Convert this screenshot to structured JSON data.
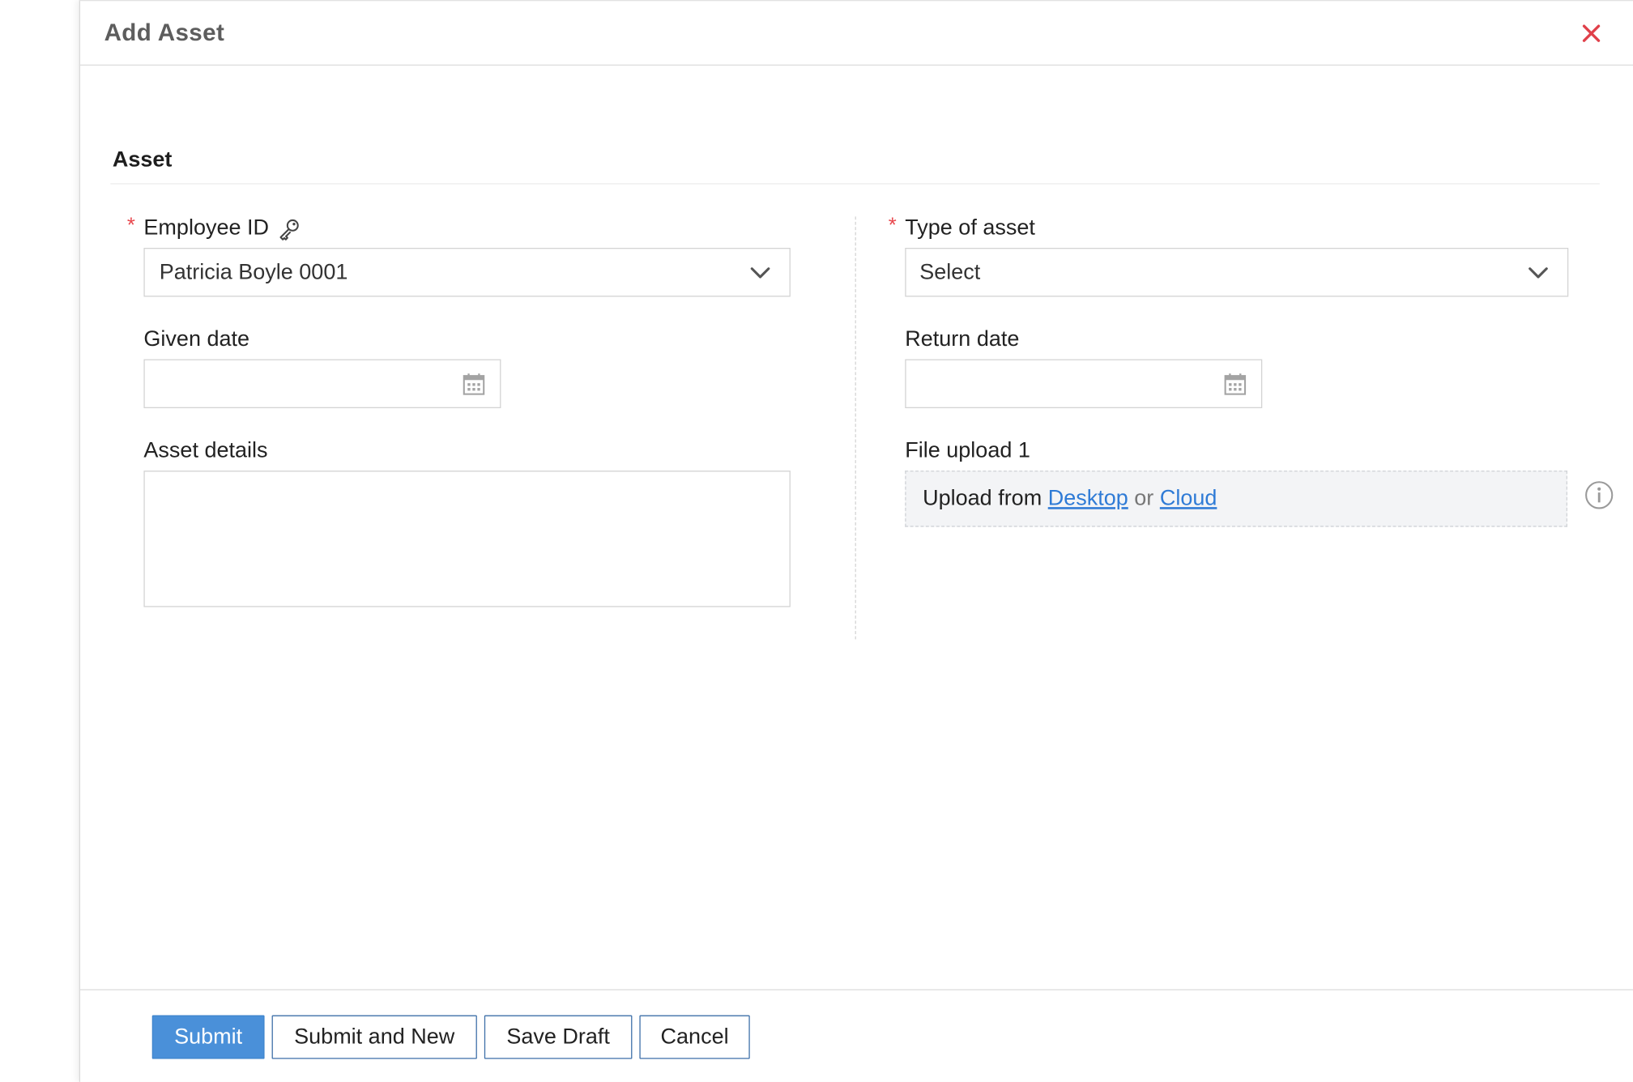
{
  "dialog": {
    "title": "Add Asset",
    "close_icon": "close-icon"
  },
  "section": {
    "title": "Asset"
  },
  "fields": {
    "required_marker": "*",
    "employee_id": {
      "label": "Employee ID",
      "value": "Patricia Boyle 0001",
      "lookup_icon": "key-icon",
      "dropdown_icon": "chevron-down-icon"
    },
    "type_of_asset": {
      "label": "Type of asset",
      "value": "Select",
      "dropdown_icon": "chevron-down-icon"
    },
    "given_date": {
      "label": "Given date",
      "value": "",
      "icon": "calendar-icon"
    },
    "return_date": {
      "label": "Return date",
      "value": "",
      "icon": "calendar-icon"
    },
    "asset_details": {
      "label": "Asset details",
      "value": ""
    },
    "file_upload": {
      "label": "File upload 1",
      "prefix": "Upload from",
      "desktop_link": "Desktop",
      "separator": "or",
      "cloud_link": "Cloud",
      "info_icon": "info-icon"
    }
  },
  "footer": {
    "submit": "Submit",
    "submit_and_new": "Submit and New",
    "save_draft": "Save Draft",
    "cancel": "Cancel"
  },
  "colors": {
    "primary_button": "#4a90d9",
    "link": "#2f7bd6",
    "required": "#e8484e",
    "close": "#e0404a"
  }
}
